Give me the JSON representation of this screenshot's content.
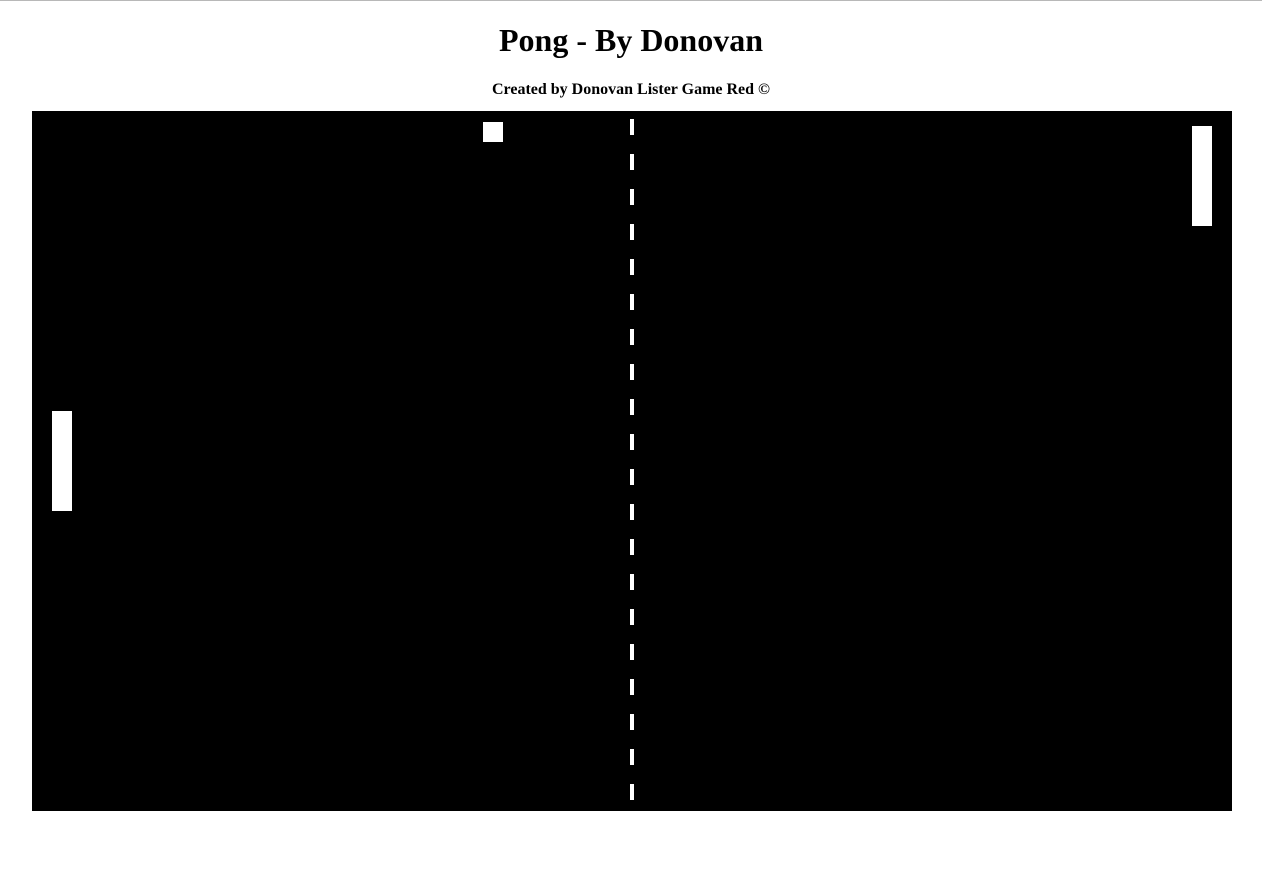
{
  "page": {
    "title": "Pong - By Donovan",
    "credit": "Created by Donovan Lister Game Red ©"
  },
  "game": {
    "background_color": "#000000",
    "foreground_color": "#ffffff",
    "net_style": "dashed"
  }
}
